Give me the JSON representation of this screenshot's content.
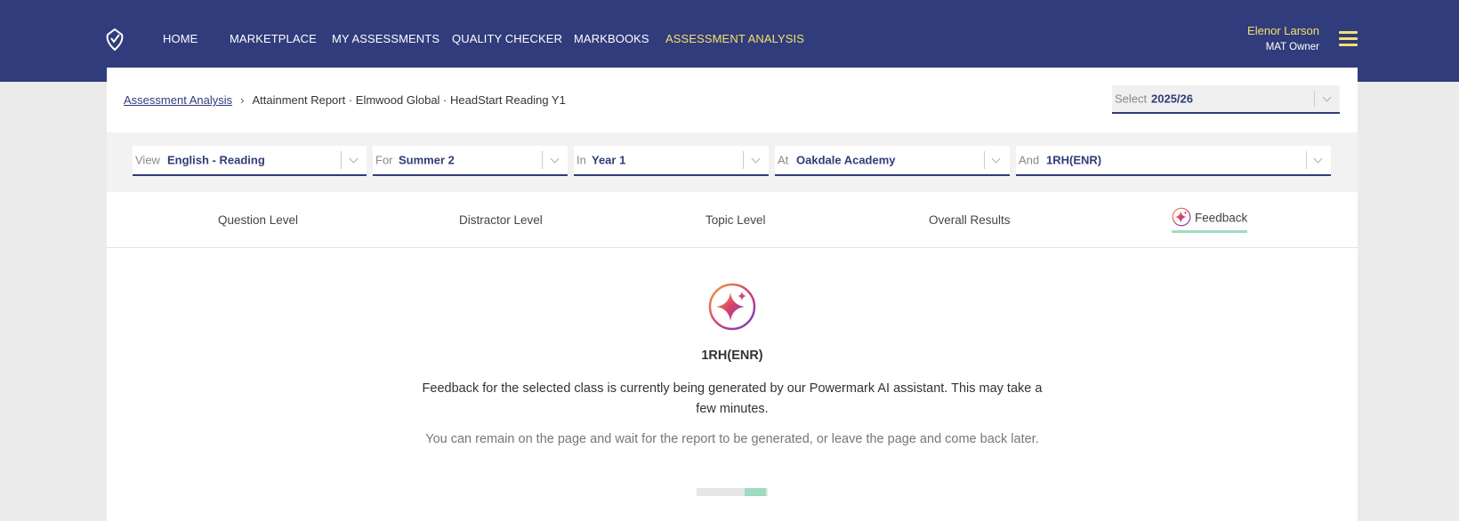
{
  "header": {
    "nav": [
      {
        "label": "HOME",
        "active": false
      },
      {
        "label": "MARKETPLACE",
        "active": false
      },
      {
        "label": "MY ASSESSMENTS",
        "active": false
      },
      {
        "label": "QUALITY CHECKER",
        "active": false
      },
      {
        "label": "MARKBOOKS",
        "active": false
      },
      {
        "label": "ASSESSMENT ANALYSIS",
        "active": true
      }
    ],
    "user": {
      "name": "Elenor Larson",
      "role": "MAT Owner"
    },
    "icons": {
      "logo": "app-logo-icon",
      "menu": "hamburger-menu-icon"
    }
  },
  "breadcrumb": {
    "link": "Assessment Analysis",
    "separator": "›",
    "current": "Attainment Report · Elmwood Global · HeadStart Reading Y1"
  },
  "year_select": {
    "prefix": "Select",
    "value": "2025/26"
  },
  "filters": [
    {
      "prefix": "View",
      "value": "English - Reading"
    },
    {
      "prefix": "For",
      "value": "Summer 2"
    },
    {
      "prefix": "In",
      "value": "Year 1"
    },
    {
      "prefix": "At",
      "value": "Oakdale Academy"
    },
    {
      "prefix": "And",
      "value": "1RH(ENR)"
    }
  ],
  "tabs": [
    {
      "label": "Question Level",
      "active": false
    },
    {
      "label": "Distractor Level",
      "active": false
    },
    {
      "label": "Topic Level",
      "active": false
    },
    {
      "label": "Overall Results",
      "active": false
    },
    {
      "label": "Feedback",
      "active": true,
      "icon": "ai-sparkle-icon"
    }
  ],
  "feedback": {
    "class_name": "1RH(ENR)",
    "message": "Feedback for the selected class is currently being generated by our Powermark AI assistant. This may take a few minutes.",
    "submessage": "You can remain on the page and wait for the report to be generated, or leave the page and come back later.",
    "progress_fraction": 0.3
  },
  "colors": {
    "header_bg": "#303c7b",
    "active_nav": "#f4e16b",
    "accent_green": "#9edbc0",
    "ai_gradient_start": "#f0a23c",
    "ai_gradient_end": "#6a3fc8"
  }
}
